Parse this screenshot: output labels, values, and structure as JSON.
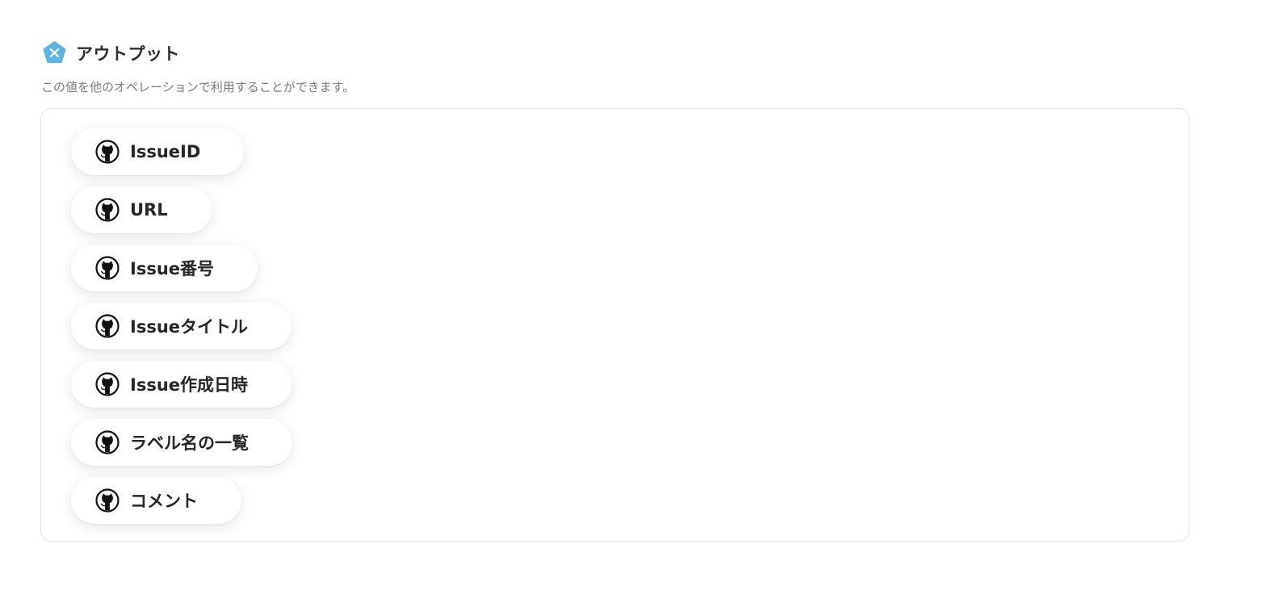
{
  "header": {
    "title": "アウトプット",
    "icon": "pentagon-x-icon",
    "icon_color": "#5bb4e3"
  },
  "subtitle": "この値を他のオペレーションで利用することができます。",
  "outputs": [
    {
      "label": "IssueID",
      "icon": "github-icon"
    },
    {
      "label": "URL",
      "icon": "github-icon"
    },
    {
      "label": "Issue番号",
      "icon": "github-icon"
    },
    {
      "label": "Issueタイトル",
      "icon": "github-icon"
    },
    {
      "label": "Issue作成日時",
      "icon": "github-icon"
    },
    {
      "label": "ラベル名の一覧",
      "icon": "github-icon"
    },
    {
      "label": "コメント",
      "icon": "github-icon"
    }
  ]
}
